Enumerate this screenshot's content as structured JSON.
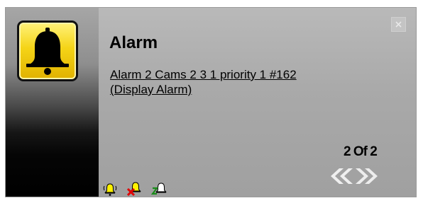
{
  "popup": {
    "title": "Alarm",
    "link_line1": "Alarm 2 Cams 2 3 1 priority 1 #162",
    "link_line2": "(Display Alarm)",
    "counter": "2 Of 2",
    "main_icon": "bell-icon",
    "close_icon": "close-icon",
    "nav_prev_icon": "double-chevron-left-icon",
    "nav_next_icon": "double-chevron-right-icon",
    "toolbar": [
      "acknowledge-bell-icon",
      "clear-bell-icon",
      "snooze-bell-icon"
    ],
    "colors": {
      "bell_yellow": "#f5d417",
      "panel_gray": "#a9a9a9",
      "clear_red": "#e00000",
      "snooze_green": "#1a8a1a"
    }
  }
}
